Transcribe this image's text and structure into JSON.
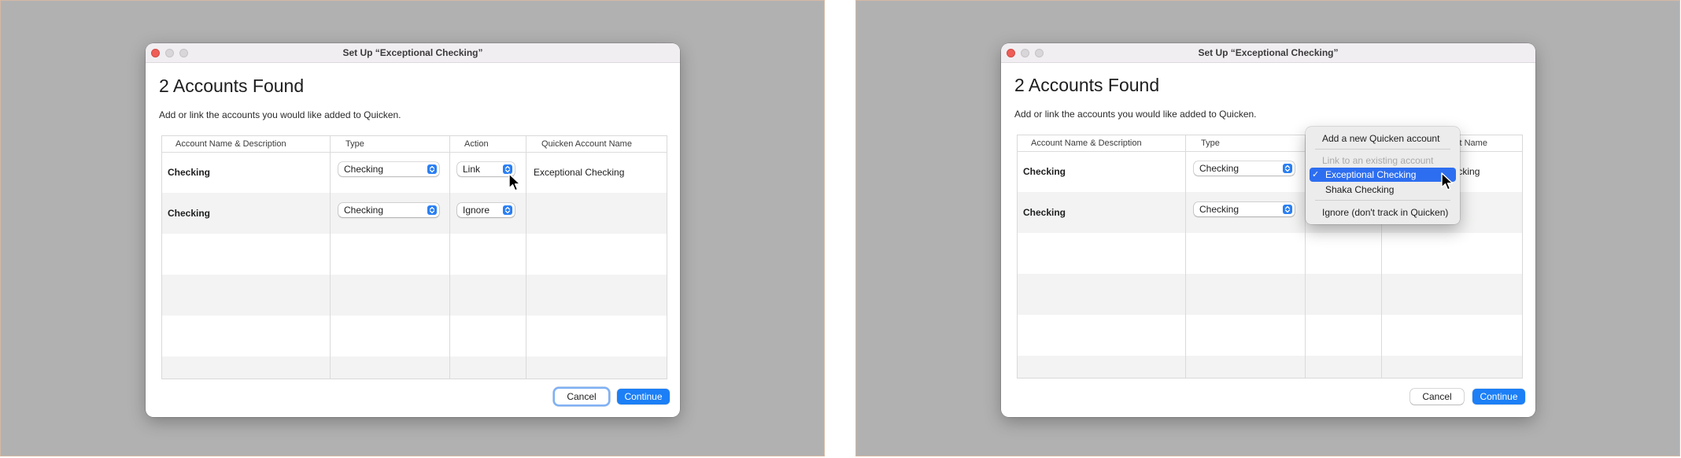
{
  "dialog": {
    "title": "Set Up “Exceptional Checking”",
    "heading": "2 Accounts Found",
    "subtext": "Add or link the accounts you would like added to Quicken."
  },
  "table": {
    "columns": [
      "Account Name & Description",
      "Type",
      "Action",
      "Quicken Account Name"
    ],
    "rows": [
      {
        "name": "Checking",
        "type": "Checking",
        "action": "Link",
        "quicken_name": "Exceptional Checking"
      },
      {
        "name": "Checking",
        "type": "Checking",
        "action": "Ignore",
        "quicken_name": ""
      }
    ]
  },
  "buttons": {
    "cancel": "Cancel",
    "continue": "Continue"
  },
  "action_menu": {
    "add_new": "Add a new Quicken account",
    "link_header": "Link to an existing account",
    "options": [
      "Exceptional Checking",
      "Shaka Checking"
    ],
    "selected": "Exceptional Checking",
    "checkmark": "✓",
    "ignore": "Ignore (don't track in Quicken)"
  },
  "colors": {
    "accent": "#1c7ff6",
    "desktop": "#b1b1b1",
    "menu_highlight": "#2d6ef0"
  },
  "icons": [
    "updown-arrows-icon",
    "mouse-pointer-icon",
    "checkmark-icon"
  ]
}
